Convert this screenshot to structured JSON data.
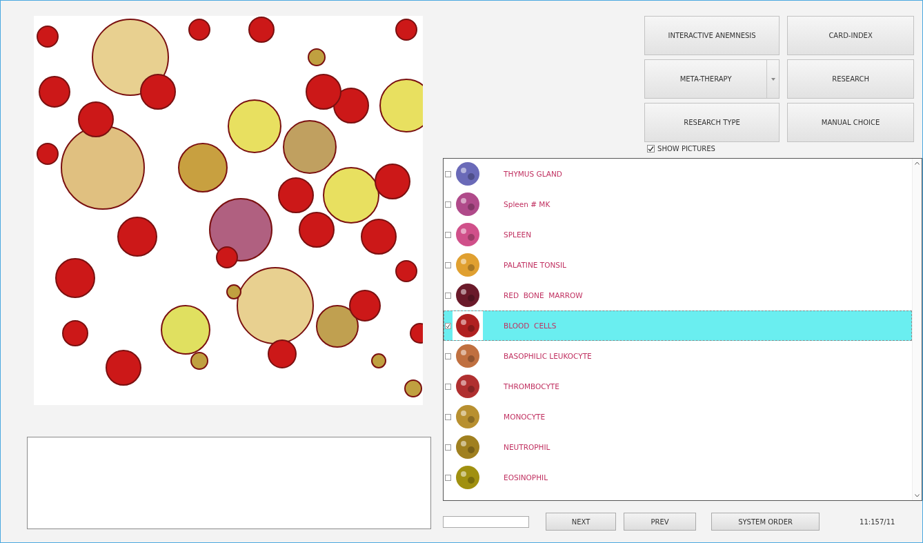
{
  "buttons": [
    {
      "label": "INTERACTIVE ANEMNESIS",
      "dropdown": false
    },
    {
      "label": "CARD-INDEX",
      "dropdown": false
    },
    {
      "label": "META-THERAPY",
      "dropdown": true
    },
    {
      "label": "RESEARCH",
      "dropdown": false
    },
    {
      "label": "RESEARCH TYPE",
      "dropdown": false
    },
    {
      "label": "MANUAL CHOICE",
      "dropdown": false
    }
  ],
  "show_pictures": {
    "label": "SHOW PICTURES",
    "checked": true
  },
  "list": [
    {
      "name": "THYMUS GLAND",
      "checked": false,
      "selected": false,
      "color": "#6a6ab8"
    },
    {
      "name": "Spleen # MK",
      "checked": false,
      "selected": false,
      "color": "#b04a8a"
    },
    {
      "name": "SPLEEN",
      "checked": false,
      "selected": false,
      "color": "#d0508a"
    },
    {
      "name": "PALATINE TONSIL",
      "checked": false,
      "selected": false,
      "color": "#e0a030"
    },
    {
      "name": "RED  BONE  MARROW",
      "checked": false,
      "selected": false,
      "color": "#6a1a2a"
    },
    {
      "name": "BLOOD  CELLS",
      "checked": true,
      "selected": true,
      "color": "#b02020"
    },
    {
      "name": "BASOPHILIC LEUKOCYTE",
      "checked": false,
      "selected": false,
      "color": "#c07040"
    },
    {
      "name": "THROMBOCYTE",
      "checked": false,
      "selected": false,
      "color": "#b03030"
    },
    {
      "name": "MONOCYTE",
      "checked": false,
      "selected": false,
      "color": "#b89030"
    },
    {
      "name": "NEUTROPHIL",
      "checked": false,
      "selected": false,
      "color": "#a08020"
    },
    {
      "name": "EOSINOPHIL",
      "checked": false,
      "selected": false,
      "color": "#a09010"
    }
  ],
  "nav": [
    "NEXT",
    "PREV",
    "SYSTEM ORDER"
  ],
  "counter": "11:157/11"
}
